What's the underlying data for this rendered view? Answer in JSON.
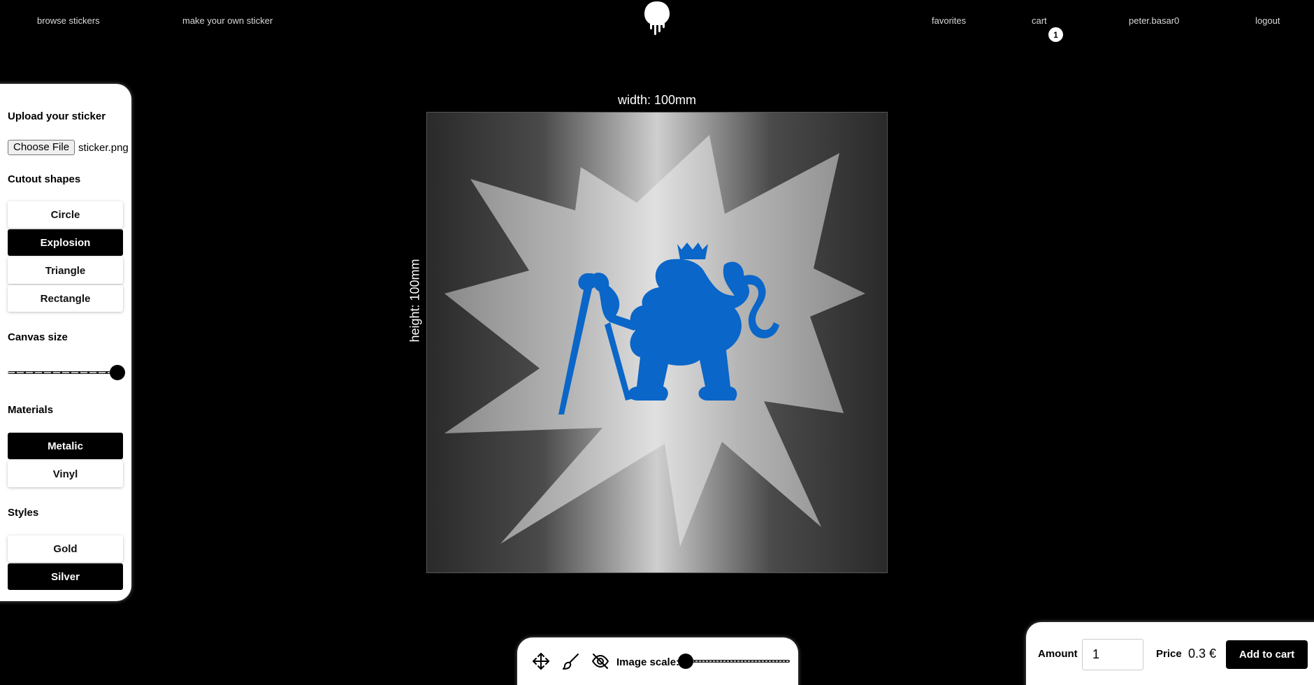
{
  "nav": {
    "browse": "browse stickers",
    "make": "make your own sticker",
    "favorites": "favorites",
    "cart": "cart",
    "cart_count": "1",
    "user": "peter.basar0",
    "logout": "logout"
  },
  "upload": {
    "heading": "Upload your sticker",
    "choose_file": "Choose File",
    "file_name": "sticker.png"
  },
  "cutout": {
    "heading": "Cutout shapes",
    "options": [
      "Circle",
      "Explosion",
      "Triangle",
      "Rectangle"
    ],
    "selected": "Explosion"
  },
  "canvas_size": {
    "heading": "Canvas size",
    "value_fraction": 1.0
  },
  "materials": {
    "heading": "Materials",
    "options": [
      "Metalic",
      "Vinyl"
    ],
    "selected": "Metalic"
  },
  "styles": {
    "heading": "Styles",
    "options": [
      "Gold",
      "Silver"
    ],
    "selected": "Silver"
  },
  "canvas": {
    "width_label": "width: 100mm",
    "height_label": "height: 100mm",
    "logo_color": "#0a66c8"
  },
  "toolbar": {
    "move_icon": "move-icon",
    "brush_icon": "brush-icon",
    "hide_icon": "eye-off-icon",
    "scale_label": "Image scale:",
    "scale_fraction": 0.0
  },
  "order": {
    "amount_label": "Amount",
    "amount_value": "1",
    "price_label": "Price",
    "price_value": "0.3 €",
    "add_to_cart": "Add to cart"
  }
}
